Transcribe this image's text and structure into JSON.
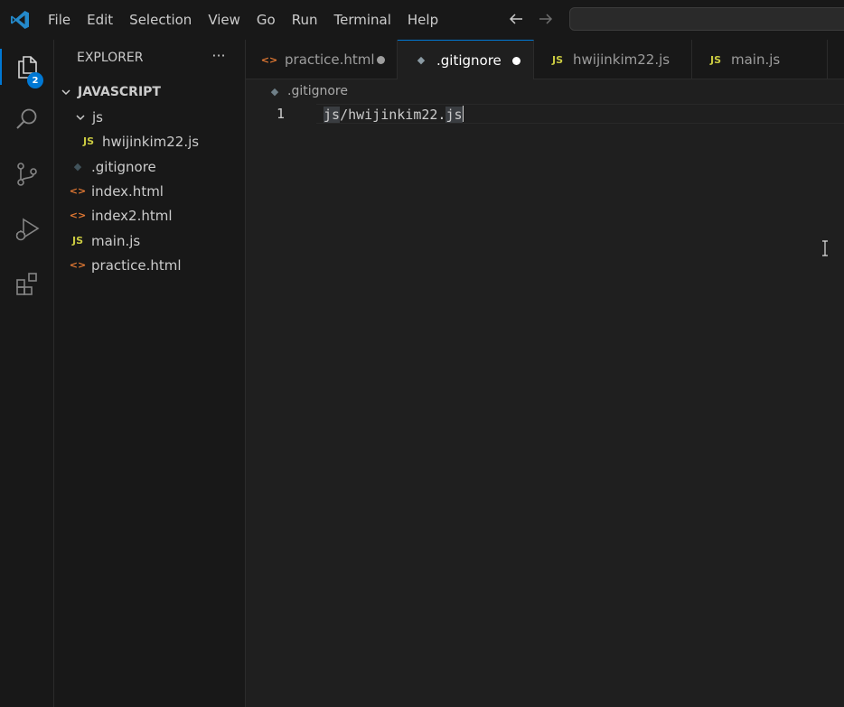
{
  "menu": [
    "File",
    "Edit",
    "Selection",
    "View",
    "Go",
    "Run",
    "Terminal",
    "Help"
  ],
  "activity": {
    "explorer_badge": "2"
  },
  "explorer": {
    "title": "EXPLORER",
    "more": "···",
    "root_folder": "JAVASCRIPT",
    "items": [
      {
        "label": "js",
        "type": "folder"
      },
      {
        "label": "hwijinkim22.js",
        "type": "js",
        "icon_text": "JS"
      },
      {
        "label": ".gitignore",
        "type": "git",
        "icon_text": "◆"
      },
      {
        "label": "index.html",
        "type": "html",
        "icon_text": "<>"
      },
      {
        "label": "index2.html",
        "type": "html",
        "icon_text": "<>"
      },
      {
        "label": "main.js",
        "type": "js",
        "icon_text": "JS"
      },
      {
        "label": "practice.html",
        "type": "html",
        "icon_text": "<>"
      }
    ]
  },
  "tabs": [
    {
      "label": "practice.html",
      "icon_text": "<>",
      "modified": true
    },
    {
      "label": ".gitignore",
      "icon_text": "◆",
      "modified": true,
      "active": true
    },
    {
      "label": "hwijinkim22.js",
      "icon_text": "JS"
    },
    {
      "label": "main.js",
      "icon_text": "JS"
    }
  ],
  "editor": {
    "breadcrumb": ".gitignore",
    "line_number": "1",
    "code_sel_start": "js",
    "code_middle": "/hwijinkim22.",
    "code_sel_end": "js"
  },
  "colors": {
    "accent": "#0078d4",
    "js": "#cbcb41",
    "html": "#e37933",
    "git": "#41535b"
  }
}
